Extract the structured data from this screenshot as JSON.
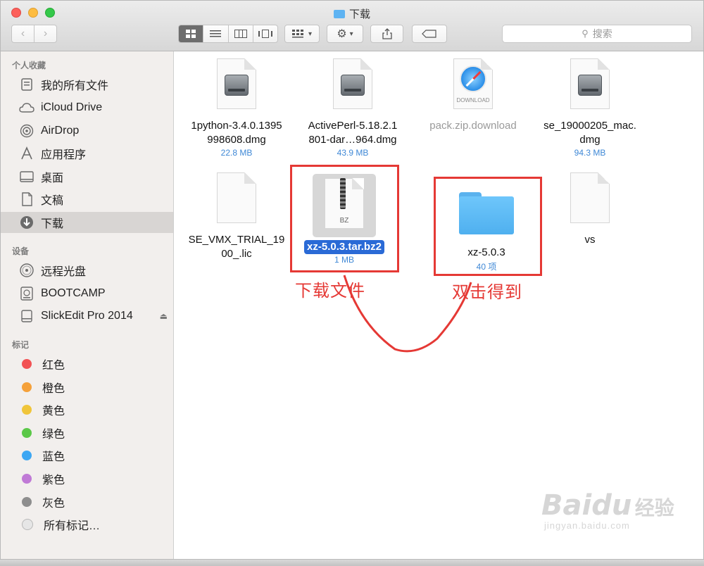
{
  "window": {
    "title": "下载"
  },
  "toolbar": {
    "back_icon": "chevron-left-icon",
    "forward_icon": "chevron-right-icon",
    "search_placeholder": "搜索"
  },
  "sidebar": {
    "favorites_header": "个人收藏",
    "favorites": [
      {
        "label": "我的所有文件",
        "icon": "all-files-icon"
      },
      {
        "label": "iCloud Drive",
        "icon": "cloud-icon"
      },
      {
        "label": "AirDrop",
        "icon": "airdrop-icon"
      },
      {
        "label": "应用程序",
        "icon": "applications-icon"
      },
      {
        "label": "桌面",
        "icon": "desktop-icon"
      },
      {
        "label": "文稿",
        "icon": "documents-icon"
      },
      {
        "label": "下载",
        "icon": "downloads-icon"
      }
    ],
    "devices_header": "设备",
    "devices": [
      {
        "label": "远程光盘",
        "icon": "remote-disc-icon"
      },
      {
        "label": "BOOTCAMP",
        "icon": "hard-drive-icon"
      },
      {
        "label": "SlickEdit Pro 2014",
        "icon": "disk-image-icon"
      }
    ],
    "tags_header": "标记",
    "tags": [
      {
        "label": "红色",
        "color": "#f25254"
      },
      {
        "label": "橙色",
        "color": "#f5a13a"
      },
      {
        "label": "黄色",
        "color": "#f0c53a"
      },
      {
        "label": "绿色",
        "color": "#5bc848"
      },
      {
        "label": "蓝色",
        "color": "#3da7f3"
      },
      {
        "label": "紫色",
        "color": "#c07ad6"
      },
      {
        "label": "灰色",
        "color": "#8e8e8e"
      },
      {
        "label": "所有标记…",
        "color": "#e6e6e6"
      }
    ]
  },
  "files": [
    {
      "name_line1": "1python-3.4.0.1395",
      "name_line2": "998608.dmg",
      "size": "22.8 MB",
      "kind": "dmg"
    },
    {
      "name_line1": "ActivePerl-5.18.2.1",
      "name_line2": "801-dar…964.dmg",
      "size": "43.9 MB",
      "kind": "dmg"
    },
    {
      "name_line1": "pack.zip.download",
      "name_line2": "",
      "size": "",
      "kind": "download",
      "icon_label": "DOWNLOAD"
    },
    {
      "name_line1": "se_19000205_mac.",
      "name_line2": "dmg",
      "size": "94.3 MB",
      "kind": "dmg"
    },
    {
      "name_line1": "SE_VMX_TRIAL_19",
      "name_line2": "00_.lic",
      "size": "",
      "kind": "doc"
    },
    {
      "name_line1": "xz-5.0.3.tar.bz2",
      "name_line2": "",
      "size": "1 MB",
      "kind": "bz2",
      "icon_label": "BZ"
    },
    {
      "name_line1": "xz-5.0.3",
      "name_line2": "",
      "size": "40 项",
      "kind": "folder"
    },
    {
      "name_line1": "vs",
      "name_line2": "",
      "size": "",
      "kind": "doc"
    }
  ],
  "annotations": {
    "left_label": "下载文件",
    "right_label": "双击得到",
    "color": "#e53935"
  },
  "watermark": {
    "brand": "Baidu",
    "brand_cn": "经验",
    "url": "jingyan.baidu.com"
  }
}
